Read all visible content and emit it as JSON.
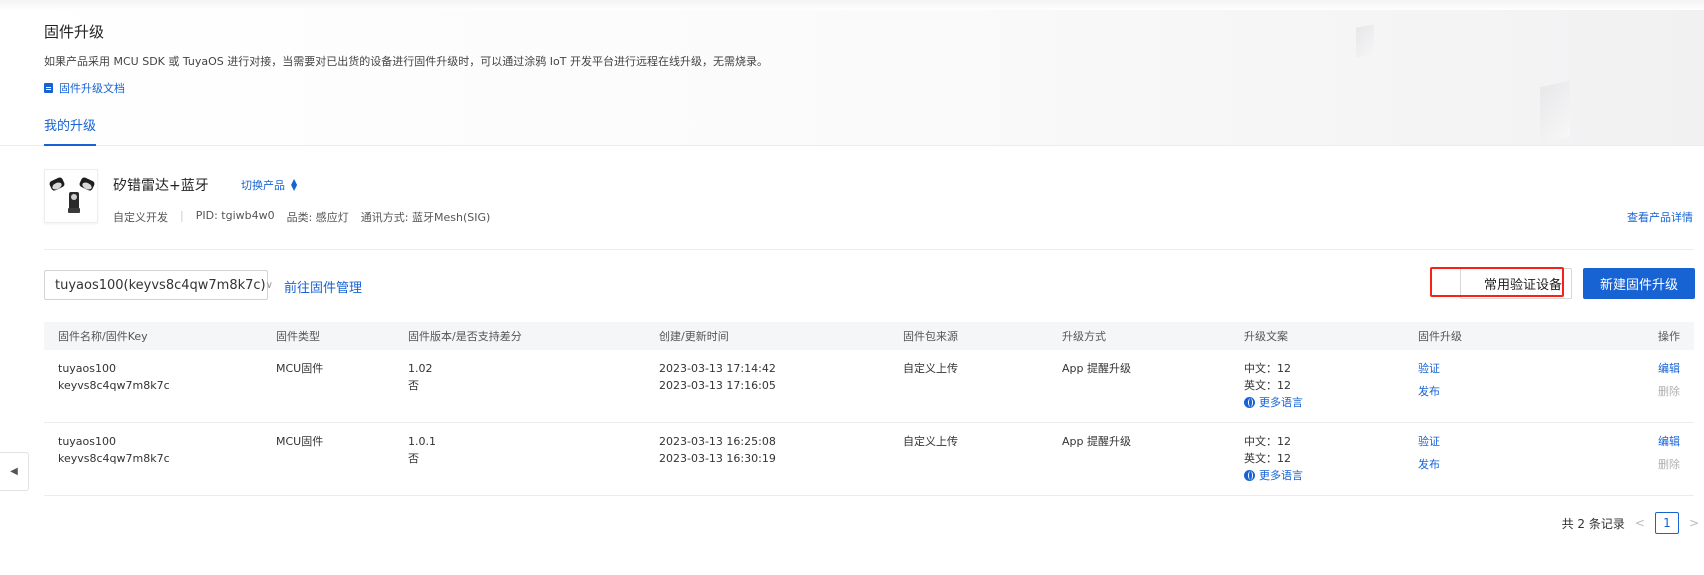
{
  "header": {
    "title": "固件升级",
    "description": "如果产品采用 MCU SDK 或 TuyaOS 进行对接，当需要对已出货的设备进行固件升级时，可以通过涂鸦 IoT 开发平台进行远程在线升级，无需烧录。",
    "doc_link": "固件升级文档"
  },
  "tabs": [
    {
      "label": "我的升级",
      "active": true
    }
  ],
  "product": {
    "name": "矽错雷达+蓝牙",
    "switch_label": "切换产品",
    "dev_type": "自定义开发",
    "pid": "PID: tgiwb4w0",
    "category": "品类: 感应灯",
    "protocol": "通讯方式: 蓝牙Mesh(SIG)",
    "detail_link": "查看产品详情"
  },
  "toolbar": {
    "select_value": "tuyaos100(keyvs8c4qw7m8k7c)",
    "goto_manage": "前往固件管理",
    "verify_devices": "常用验证设备",
    "new_upgrade": "新建固件升级"
  },
  "table": {
    "columns": [
      "固件名称/固件Key",
      "固件类型",
      "固件版本/是否支持差分",
      "创建/更新时间",
      "固件包来源",
      "升级方式",
      "升级文案",
      "固件升级",
      "操作"
    ],
    "rows": [
      {
        "name": "tuyaos100",
        "key": "keyvs8c4qw7m8k7c",
        "type": "MCU固件",
        "version": "1.02",
        "diff": "否",
        "created": "2023-03-13 17:14:42",
        "updated": "2023-03-13 17:16:05",
        "source": "自定义上传",
        "method": "App 提醒升级",
        "copy_cn": "中文：12",
        "copy_en": "英文：12",
        "more_lang": "更多语言",
        "verify": "验证",
        "publish": "发布",
        "edit": "编辑",
        "delete": "删除"
      },
      {
        "name": "tuyaos100",
        "key": "keyvs8c4qw7m8k7c",
        "type": "MCU固件",
        "version": "1.0.1",
        "diff": "否",
        "created": "2023-03-13 16:25:08",
        "updated": "2023-03-13 16:30:19",
        "source": "自定义上传",
        "method": "App 提醒升级",
        "copy_cn": "中文：12",
        "copy_en": "英文：12",
        "more_lang": "更多语言",
        "verify": "验证",
        "publish": "发布",
        "edit": "编辑",
        "delete": "删除"
      }
    ]
  },
  "pagination": {
    "total_text": "共 2 条记录",
    "current_page": "1",
    "prev": "<",
    "next": ">"
  },
  "colors": {
    "primary": "#1763d4",
    "highlight": "#f5221b"
  }
}
